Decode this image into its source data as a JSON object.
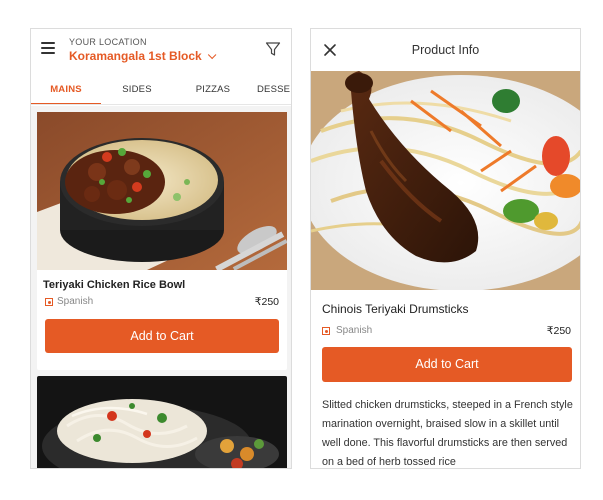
{
  "colors": {
    "accent": "#e55a25",
    "text": "#222222",
    "muted": "#888888",
    "border": "#dcdcdc"
  },
  "menu_screen": {
    "location": {
      "caption": "YOUR LOCATION",
      "value": "Koramangala 1st Block"
    },
    "icons": {
      "menu": "hamburger-icon",
      "location_dropdown": "chevron-down-icon",
      "filter": "filter-icon"
    },
    "tabs": [
      {
        "label": "MAINS",
        "active": true
      },
      {
        "label": "SIDES",
        "active": false
      },
      {
        "label": "PIZZAS",
        "active": false
      },
      {
        "label": "DESSERTS",
        "active": false
      }
    ],
    "items": [
      {
        "name": "Teriyaki Chicken Rice Bowl",
        "cuisine": "Spanish",
        "price": "₹250",
        "cta": "Add to Cart"
      }
    ]
  },
  "product_screen": {
    "title": "Product Info",
    "icons": {
      "close": "close-icon"
    },
    "product": {
      "name": "Chinois Teriyaki Drumsticks",
      "cuisine": "Spanish",
      "price": "₹250",
      "cta": "Add to Cart",
      "description": "Slitted chicken drumsticks, steeped in a French style marination overnight, braised slow in a skillet until well done. This flavorful drumsticks are then served on a bed of herb tossed rice"
    }
  }
}
